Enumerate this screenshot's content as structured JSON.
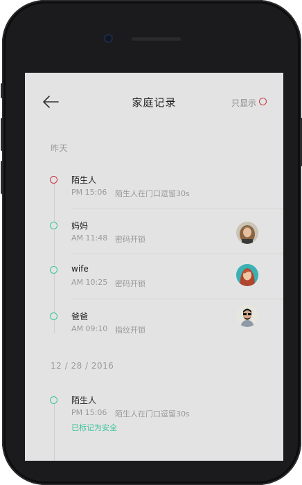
{
  "header": {
    "title": "家庭记录",
    "only_show_label": "只显示"
  },
  "sections": [
    {
      "label": "昨天",
      "records": [
        {
          "name": "陌生人",
          "time": "PM 15:06",
          "desc": "陌生人在门口逗留30s",
          "status": "red"
        },
        {
          "name": "妈妈",
          "time": "AM 11:48",
          "desc": "密码开锁",
          "status": "green",
          "avatar": "mom-avatar"
        },
        {
          "name": "wife",
          "time": "AM 10:25",
          "desc": "密码开锁",
          "status": "green",
          "avatar": "wife-avatar"
        },
        {
          "name": "爸爸",
          "time": "AM 09:10",
          "desc": "指纹开锁",
          "status": "green",
          "avatar": "dad-avatar"
        }
      ]
    },
    {
      "label": "12 / 28 / 2016",
      "records": [
        {
          "name": "陌生人",
          "time": "PM 15:06",
          "desc": "陌生人在门口逗留30s",
          "status": "green",
          "tag": "已标记为安全"
        }
      ]
    }
  ],
  "colors": {
    "accent_red": "#c8343e",
    "accent_green": "#3cc39a",
    "screen_bg": "#e3e3e3"
  }
}
